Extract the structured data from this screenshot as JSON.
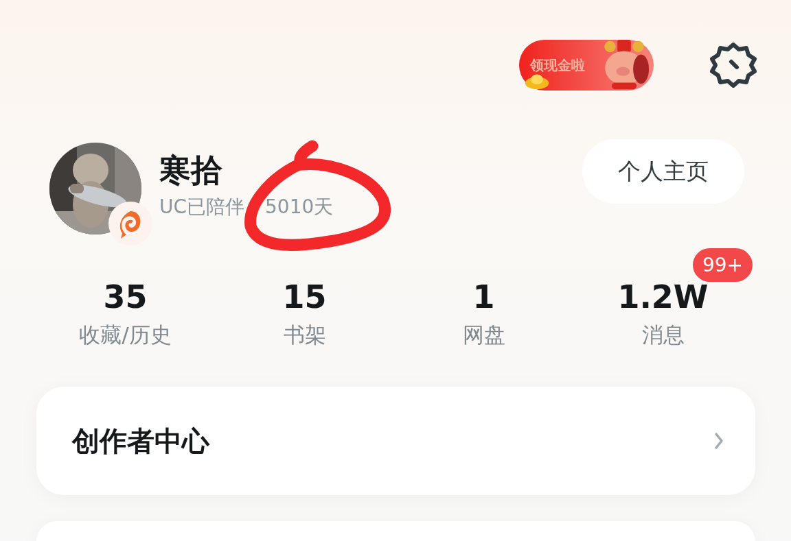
{
  "promo": {
    "label": "领现金啦"
  },
  "profile": {
    "name": "寒拾",
    "subtitle_parts": [
      "UC已陪伴",
      "5010天"
    ],
    "homepage_button": "个人主页"
  },
  "stats": [
    {
      "value": "35",
      "label": "收藏/历史"
    },
    {
      "value": "15",
      "label": "书架"
    },
    {
      "value": "1",
      "label": "网盘"
    },
    {
      "value": "1.2W",
      "label": "消息",
      "badge": "99+"
    }
  ],
  "menu": [
    {
      "label": "创作者中心"
    }
  ]
}
